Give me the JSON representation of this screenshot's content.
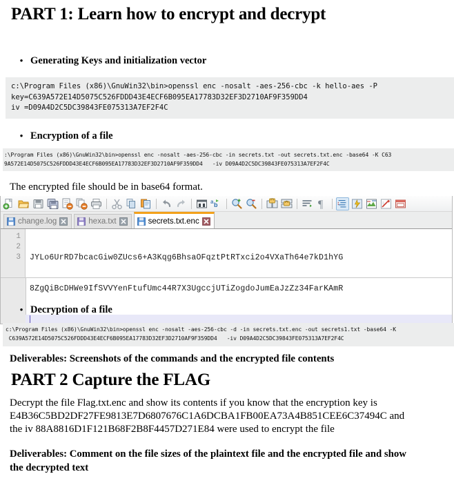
{
  "document": {
    "part1_title": "PART 1: Learn how to encrypt and decrypt",
    "bullet1": "Generating Keys and initialization vector",
    "code1": "c:\\Program Files (x86)\\GnuWin32\\bin>openssl enc -nosalt -aes-256-cbc -k hello-aes -P\nkey=C639A572E14D5075C526FDDD43E4ECF6B095EA17783D32EF3D2710AF9F359DD4\niv =D09A4D2C5DC39843FE075313A7EF2F4C",
    "bullet2": "Encryption of a file",
    "code2": ":\\Program Files (x86)\\GnuWin32\\bin>openssl enc -nosalt -aes-256-cbc -in secrets.txt -out secrets.txt.enc -base64 -K C63\n9A572E14D5075C526FDDD43E4ECF6B095EA17783D32EF3D2710AF9F359DD4   -iv D09A4D2C5DC39843FE075313A7EF2F4C",
    "note_base64": "The encrypted file should be in base64 format.",
    "bullet3": "Decryption  of a file",
    "code3": "c:\\Program Files (x86)\\GnuWin32\\bin>openssl enc -nosalt -aes-256-cbc -d -in secrets.txt.enc -out secrets1.txt -base64 -K\n C639A572E14D5075C526FDDD43E4ECF6B095EA17783D32EF3D2710AF9F359DD4   -iv D09A4D2C5DC39843FE075313A7EF2F4C",
    "deliverables1": "Deliverables: Screenshots of the commands and the encrypted file contents",
    "part2_title": "PART 2 Capture the FLAG",
    "part2_body_line1": "Decrypt the file Flag.txt.enc and show its contents if you know that the encryption key  is",
    "part2_body_line2": "E4B36C5BD2DF27FE9813E7D6807676C1A6DCBA1FB00EA73A4B851CEE6C37494C and",
    "part2_body_line3": "the iv 88A8816D1F121B68F2B8F4457D271E84 were used to encrypt  the file",
    "deliverables2_line1": "Deliverables: Comment on the file sizes of the plaintext file and the encrypted file and show",
    "deliverables2_line2": "the decrypted text"
  },
  "editor": {
    "toolbar": [
      {
        "name": "new-file-icon",
        "label": "New"
      },
      {
        "name": "open-file-icon",
        "label": "Open"
      },
      {
        "name": "save-icon",
        "label": "Save"
      },
      {
        "name": "save-all-icon",
        "label": "Save All"
      },
      {
        "name": "close-file-icon",
        "label": "Close"
      },
      {
        "name": "close-all-icon",
        "label": "Close All"
      },
      {
        "name": "print-icon",
        "label": "Print"
      },
      {
        "name": "cut-icon",
        "label": "Cut"
      },
      {
        "name": "copy-icon",
        "label": "Copy"
      },
      {
        "name": "paste-icon",
        "label": "Paste"
      },
      {
        "name": "undo-icon",
        "label": "Undo"
      },
      {
        "name": "redo-icon",
        "label": "Redo"
      },
      {
        "name": "find-icon",
        "label": "Find"
      },
      {
        "name": "replace-icon",
        "label": "Replace"
      },
      {
        "name": "zoom-in-icon",
        "label": "Zoom In"
      },
      {
        "name": "zoom-out-icon",
        "label": "Zoom Out"
      },
      {
        "name": "sync-vertical-icon",
        "label": "Sync Vertical Scrolling"
      },
      {
        "name": "sync-horizontal-icon",
        "label": "Sync Horizontal Scrolling"
      },
      {
        "name": "word-wrap-icon",
        "label": "Word Wrap"
      },
      {
        "name": "show-all-chars-icon",
        "label": "Show All Characters"
      },
      {
        "name": "indent-guide-icon",
        "label": "Show Indent Guide"
      },
      {
        "name": "user-defined-dialog-icon",
        "label": "User Defined Dialogue"
      },
      {
        "name": "document-map-icon",
        "label": "Document Map"
      },
      {
        "name": "function-list-icon",
        "label": "Function List"
      },
      {
        "name": "folder-workspace-icon",
        "label": "Folder as Workspace"
      }
    ],
    "tabs": [
      {
        "name": "tab-change-log",
        "label": "change.log",
        "active": false
      },
      {
        "name": "tab-hexa-txt",
        "label": "hexa.txt",
        "active": false
      },
      {
        "name": "tab-secrets-txt-enc",
        "label": "secrets.txt.enc",
        "active": true
      }
    ],
    "line_numbers": [
      "1",
      "2",
      "3"
    ],
    "content_line1": "JYLo6UrRD7bcacGiw0ZUcs6+A3Kqg6BhsaOFqztPtRTxci2o4VXaTh64e7kD1hYG",
    "content_line2": "8ZgQiBcDHWe9IfSVVYenFtufUmc44R7X3UgccjUTiZogdoJumEaJzZz34FarKAmR",
    "content_line3": ""
  },
  "colors": {
    "code_background": "#eceded",
    "active_tab_accent": "#f3a11a",
    "caret_line": "#e8e8f8",
    "gutter": "#e9e9e9"
  }
}
